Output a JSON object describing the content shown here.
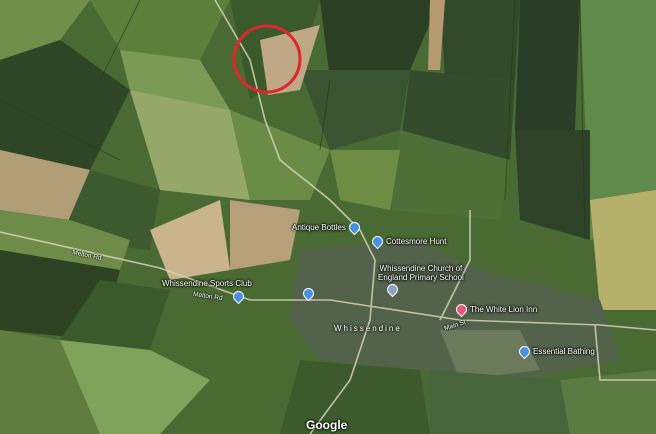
{
  "map": {
    "attribution": "Google",
    "village_label": "Whissendine",
    "roads": {
      "melton_rd_1": "Melton Rd",
      "melton_rd_2": "Melton Rd",
      "main_st": "Main St"
    },
    "pois": {
      "antique_bottles": "Antique Bottles",
      "cottesmore_hunt": "Cottesmore Hunt",
      "church_school_line1": "Whissendine Church of",
      "church_school_line2": "England Primary School",
      "sports_club": "Whissendine Sports Club",
      "white_lion": "The White Lion Inn",
      "essential_bathing": "Essential Bathing"
    },
    "highlight_circle_color": "#e0262a"
  }
}
